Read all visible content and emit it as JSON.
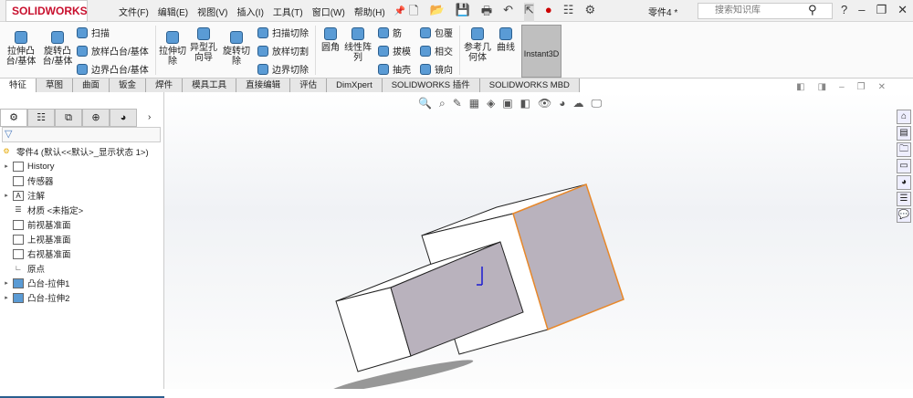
{
  "app": {
    "logo": "SOLIDWORKS",
    "document_title": "零件4 *"
  },
  "menu": [
    "文件(F)",
    "编辑(E)",
    "视图(V)",
    "插入(I)",
    "工具(T)",
    "窗口(W)",
    "帮助(H)"
  ],
  "search": {
    "placeholder": "搜索知识库"
  },
  "ribbon": {
    "extrude_boss": "拉伸凸台/基体",
    "revolve_boss": "旋转凸台/基体",
    "sweep": "扫描",
    "loft": "放样凸台/基体",
    "boundary": "边界凸台/基体",
    "extrude_cut": "拉伸切除",
    "hole_wizard": "异型孔向导",
    "revolve_cut": "旋转切除",
    "sweep_cut": "扫描切除",
    "loft_cut": "放样切割",
    "boundary_cut": "边界切除",
    "fillet": "圆角",
    "linear_pattern": "线性阵列",
    "rib": "筋",
    "draft": "拔模",
    "shell": "抽壳",
    "wrap": "包覆",
    "intersect": "相交",
    "mirror": "镜向",
    "ref_geometry": "参考几何体",
    "curves": "曲线",
    "instant3d": "Instant3D"
  },
  "tabs": [
    "特征",
    "草图",
    "曲面",
    "钣金",
    "焊件",
    "模具工具",
    "直接编辑",
    "评估",
    "DimXpert",
    "SOLIDWORKS 插件",
    "SOLIDWORKS MBD"
  ],
  "tree": {
    "root": "零件4 (默认<<默认>_显示状态 1>)",
    "items": [
      "History",
      "传感器",
      "注解",
      "材质 <未指定>",
      "前视基准面",
      "上视基准面",
      "右视基准面",
      "原点",
      "凸台-拉伸1",
      "凸台-拉伸2"
    ]
  }
}
